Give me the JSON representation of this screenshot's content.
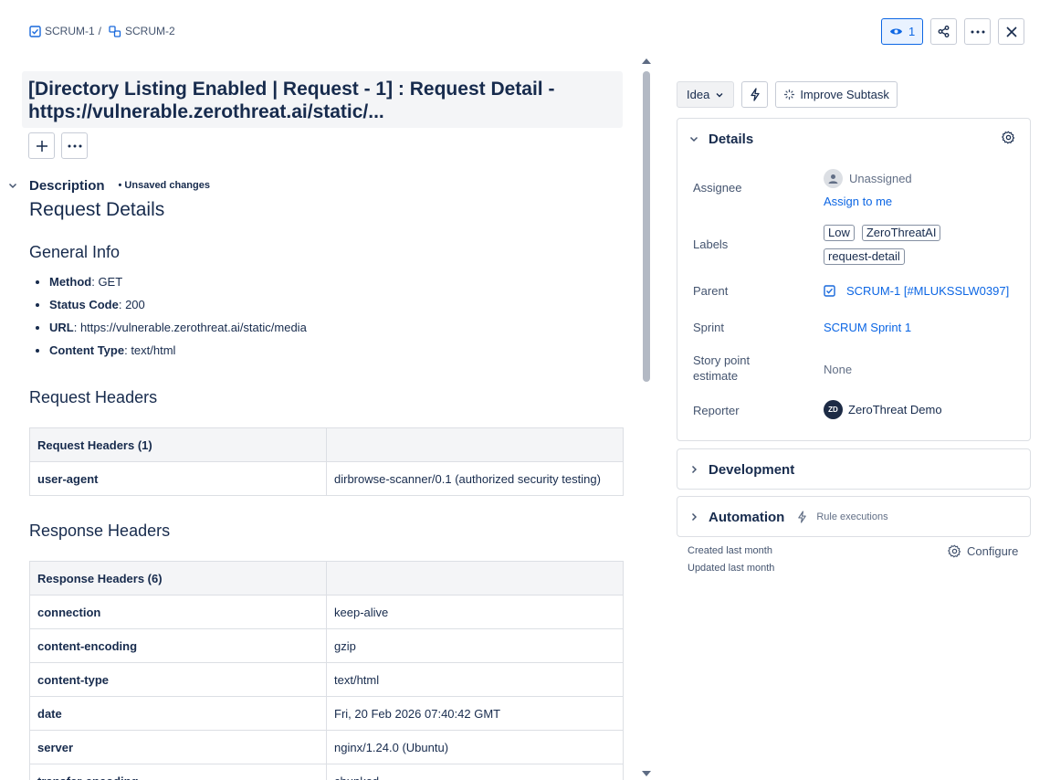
{
  "breadcrumb": {
    "parent": "SCRUM-1",
    "separator": "/",
    "current": "SCRUM-2"
  },
  "top_actions": {
    "watch_count": "1"
  },
  "issue": {
    "title": "[Directory Listing Enabled | Request - 1] : Request Detail - https://vulnerable.zerothreat.ai/static/..."
  },
  "description": {
    "label": "Description",
    "unsaved": "• Unsaved changes",
    "heading": "Request Details",
    "general_info_heading": "General Info",
    "general_info": [
      {
        "key": "Method",
        "value": ": GET"
      },
      {
        "key": "Status Code",
        "value": ": 200"
      },
      {
        "key": "URL",
        "value": ": https://vulnerable.zerothreat.ai/static/media"
      },
      {
        "key": "Content Type",
        "value": ": text/html"
      }
    ],
    "request_headers_heading": "Request Headers",
    "request_table": {
      "header": "Request Headers (1)",
      "rows": [
        {
          "key": "user-agent",
          "value": "dirbrowse-scanner/0.1 (authorized security testing)"
        }
      ]
    },
    "response_headers_heading": "Response Headers",
    "response_table": {
      "header": "Response Headers (6)",
      "rows": [
        {
          "key": "connection",
          "value": "keep-alive"
        },
        {
          "key": "content-encoding",
          "value": "gzip"
        },
        {
          "key": "content-type",
          "value": "text/html"
        },
        {
          "key": "date",
          "value": "Fri, 20 Feb 2026 07:40:42 GMT"
        },
        {
          "key": "server",
          "value": "nginx/1.24.0 (Ubuntu)"
        },
        {
          "key": "transfer-encoding",
          "value": "chunked"
        }
      ]
    }
  },
  "sidebar": {
    "status": "Idea",
    "improve_label": "Improve Subtask",
    "details": {
      "title": "Details",
      "assignee_label": "Assignee",
      "assignee_value": "Unassigned",
      "assign_to_me": "Assign to me",
      "labels_label": "Labels",
      "labels": [
        "Low",
        "ZeroThreatAI",
        "request-detail"
      ],
      "parent_label": "Parent",
      "parent_value": "SCRUM-1 [#MLUKSSLW0397]",
      "sprint_label": "Sprint",
      "sprint_value": "SCRUM Sprint 1",
      "story_points_label_1": "Story point",
      "story_points_label_2": "estimate",
      "story_points_value": "None",
      "reporter_label": "Reporter",
      "reporter_initials": "ZD",
      "reporter_value": "ZeroThreat Demo"
    },
    "development_title": "Development",
    "automation_title": "Automation",
    "automation_sub": "Rule executions",
    "created": "Created last month",
    "updated": "Updated last month",
    "configure": "Configure"
  },
  "colors": {
    "link": "#0c66e4",
    "text": "#172b4d",
    "subtle": "#44546f"
  }
}
